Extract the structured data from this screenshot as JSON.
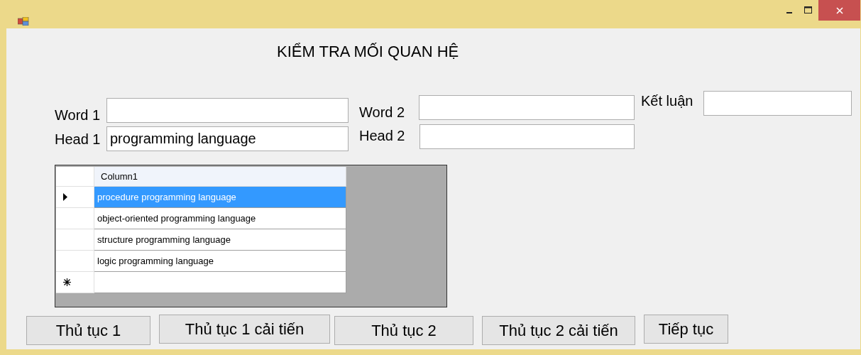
{
  "window": {
    "title": "KIỂM TRA MỐI QUAN HỆ"
  },
  "fields": [
    {
      "label": "Word 1"
    },
    {
      "label": "Head 1",
      "value": "programming language"
    },
    {
      "label": "Word 2"
    },
    {
      "label": "Head 2"
    },
    {
      "label": "Kết luận"
    }
  ],
  "grid": {
    "columns": [
      "Column1"
    ],
    "rows": [
      {
        "kind": "data",
        "cell": "procedure programming language",
        "selected": true
      },
      {
        "kind": "data",
        "cell": "object-oriented programming language",
        "selected": false
      },
      {
        "kind": "data",
        "cell": "structure programming language",
        "selected": false
      },
      {
        "kind": "data",
        "cell": "logic programming language",
        "selected": false
      },
      {
        "kind": "new"
      }
    ]
  },
  "buttons": [
    "Thủ tục 1",
    "Thủ tục 1 cải tiến",
    "Thủ tục 2",
    "Thủ tục 2 cải tiến",
    "Tiếp tục"
  ]
}
